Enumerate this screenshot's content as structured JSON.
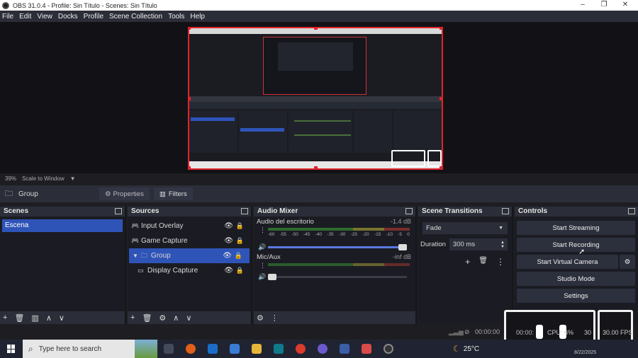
{
  "window": {
    "title": "OBS 31.0.4 - Profile: Sin Título - Scenes: Sin Título",
    "minimize": "–",
    "maximize": "❐",
    "close": "✕"
  },
  "menu": [
    "File",
    "Edit",
    "View",
    "Docks",
    "Profile",
    "Scene Collection",
    "Tools",
    "Help"
  ],
  "preview": {
    "zoom": "39%",
    "zoom_mode": "Scale to Window",
    "zoom_caret": "▼"
  },
  "context_bar": {
    "source_name": "Group",
    "properties_label": "Properties",
    "filters_label": "Filters"
  },
  "scenes": {
    "title": "Scenes",
    "items": [
      "Escena"
    ]
  },
  "sources": {
    "title": "Sources",
    "items": [
      {
        "name": "Input Overlay",
        "icon": "gamepad-icon"
      },
      {
        "name": "Game Capture",
        "icon": "gamepad-icon"
      },
      {
        "name": "Group",
        "icon": "folder-icon",
        "selected": true
      },
      {
        "name": "Display Capture",
        "icon": "monitor-icon"
      }
    ]
  },
  "audio_mixer": {
    "title": "Audio Mixer",
    "ticks": [
      "-60",
      "-55",
      "-50",
      "-45",
      "-40",
      "-35",
      "-30",
      "-25",
      "-20",
      "-15",
      "-10",
      "-5",
      "0"
    ],
    "channels": [
      {
        "name": "Audio del escritorio",
        "db": "-1.4 dB",
        "volume": 0.97
      },
      {
        "name": "Mic/Aux",
        "db": "-inf dB",
        "volume": 0.03
      }
    ]
  },
  "transitions": {
    "title": "Scene Transitions",
    "selected": "Fade",
    "duration_label": "Duration",
    "duration_value": "300 ms"
  },
  "controls": {
    "title": "Controls",
    "start_streaming": "Start Streaming",
    "start_recording": "Start Recording",
    "start_virtual_camera": "Start Virtual Camera",
    "studio_mode": "Studio Mode",
    "settings": "Settings"
  },
  "status": {
    "rec_time": "00:00:00",
    "stream_time": "00:00:",
    "cpu": "CPU: 6%",
    "fps": "30.00 FPS",
    "fps_prefix": "30"
  },
  "taskbar": {
    "search_placeholder": "Type here to search",
    "weather": "25°C",
    "date": "8/22/2025"
  },
  "colors": {
    "accent_blue": "#2f54b8",
    "canvas_border": "#e0232a",
    "panel_bg": "#1f2028",
    "header_bg": "#2b2e38"
  }
}
